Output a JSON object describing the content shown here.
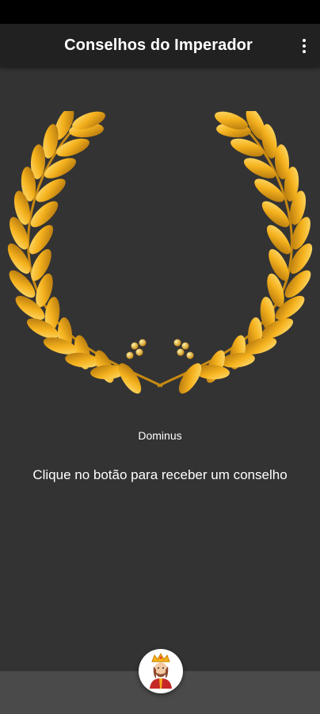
{
  "app_bar": {
    "title": "Conselhos do Imperador",
    "menu_icon": "more-vert-icon"
  },
  "main": {
    "decoration_icon": "laurel-wreath-icon",
    "author": "Dominus",
    "advice": "Clique no botão para receber um conselho"
  },
  "fab": {
    "icon": "emperor-avatar-icon"
  },
  "colors": {
    "background": "#333333",
    "app_bar": "#212121",
    "bottom_bar": "#4a4a4a",
    "gold_light": "#ffd34d",
    "gold_dark": "#a86c0a"
  }
}
